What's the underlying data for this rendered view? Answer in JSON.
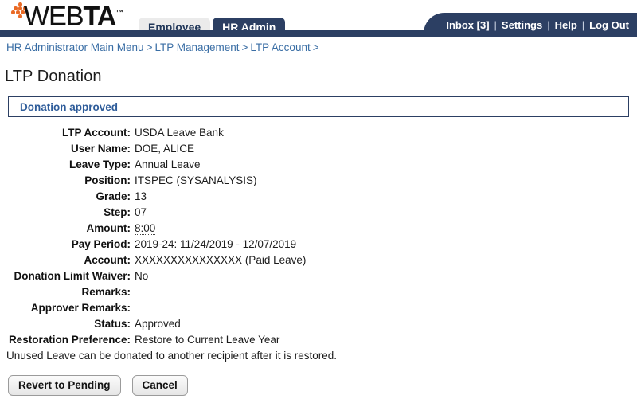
{
  "header": {
    "logo": {
      "part1": "WEB",
      "part2": "TA",
      "trademark": "™",
      "dot_color": "#ea6a25"
    },
    "tabs": [
      {
        "label": "Employee",
        "active": false
      },
      {
        "label": "HR Admin",
        "active": true
      }
    ],
    "nav_links": [
      {
        "label": "Inbox [3]"
      },
      {
        "label": "Settings"
      },
      {
        "label": "Help"
      },
      {
        "label": "Log Out"
      }
    ],
    "nav_separator": "|",
    "navy_color": "#2c3f63"
  },
  "breadcrumb": {
    "items": [
      {
        "label": "HR Administrator Main Menu"
      },
      {
        "label": "LTP Management"
      },
      {
        "label": "LTP Account"
      }
    ],
    "separator": ">",
    "trailing_separator": ">",
    "link_color": "#3a6ea5"
  },
  "page": {
    "title": "LTP Donation"
  },
  "banner": {
    "message": "Donation approved",
    "text_color": "#2e5c9a",
    "border_color": "#2c3f63"
  },
  "details": [
    {
      "label": "LTP Account:",
      "value": "USDA Leave Bank",
      "tooltip": false
    },
    {
      "label": "User Name:",
      "value": "DOE, ALICE",
      "tooltip": false
    },
    {
      "label": "Leave Type:",
      "value": "Annual Leave",
      "tooltip": false
    },
    {
      "label": "Position:",
      "value": "ITSPEC (SYSANALYSIS)",
      "tooltip": false
    },
    {
      "label": "Grade:",
      "value": "13",
      "tooltip": false
    },
    {
      "label": "Step:",
      "value": "07",
      "tooltip": false
    },
    {
      "label": "Amount:",
      "value": "8:00",
      "tooltip": true
    },
    {
      "label": "Pay Period:",
      "value": "2019-24: 11/24/2019 - 12/07/2019",
      "tooltip": false
    },
    {
      "label": "Account:",
      "value": "XXXXXXXXXXXXXXX (Paid Leave)",
      "tooltip": false
    },
    {
      "label": "Donation Limit Waiver:",
      "value": "No",
      "tooltip": false
    },
    {
      "label": "Remarks:",
      "value": "",
      "tooltip": false
    },
    {
      "label": "Approver Remarks:",
      "value": "",
      "tooltip": false
    },
    {
      "label": "Status:",
      "value": "Approved",
      "tooltip": false
    },
    {
      "label": "Restoration Preference:",
      "value": "Restore to Current Leave Year",
      "tooltip": false
    }
  ],
  "note": "Unused Leave can be donated to another recipient after it is restored.",
  "buttons": [
    {
      "label": "Revert to Pending",
      "name": "revert-to-pending-button"
    },
    {
      "label": "Cancel",
      "name": "cancel-button"
    }
  ]
}
